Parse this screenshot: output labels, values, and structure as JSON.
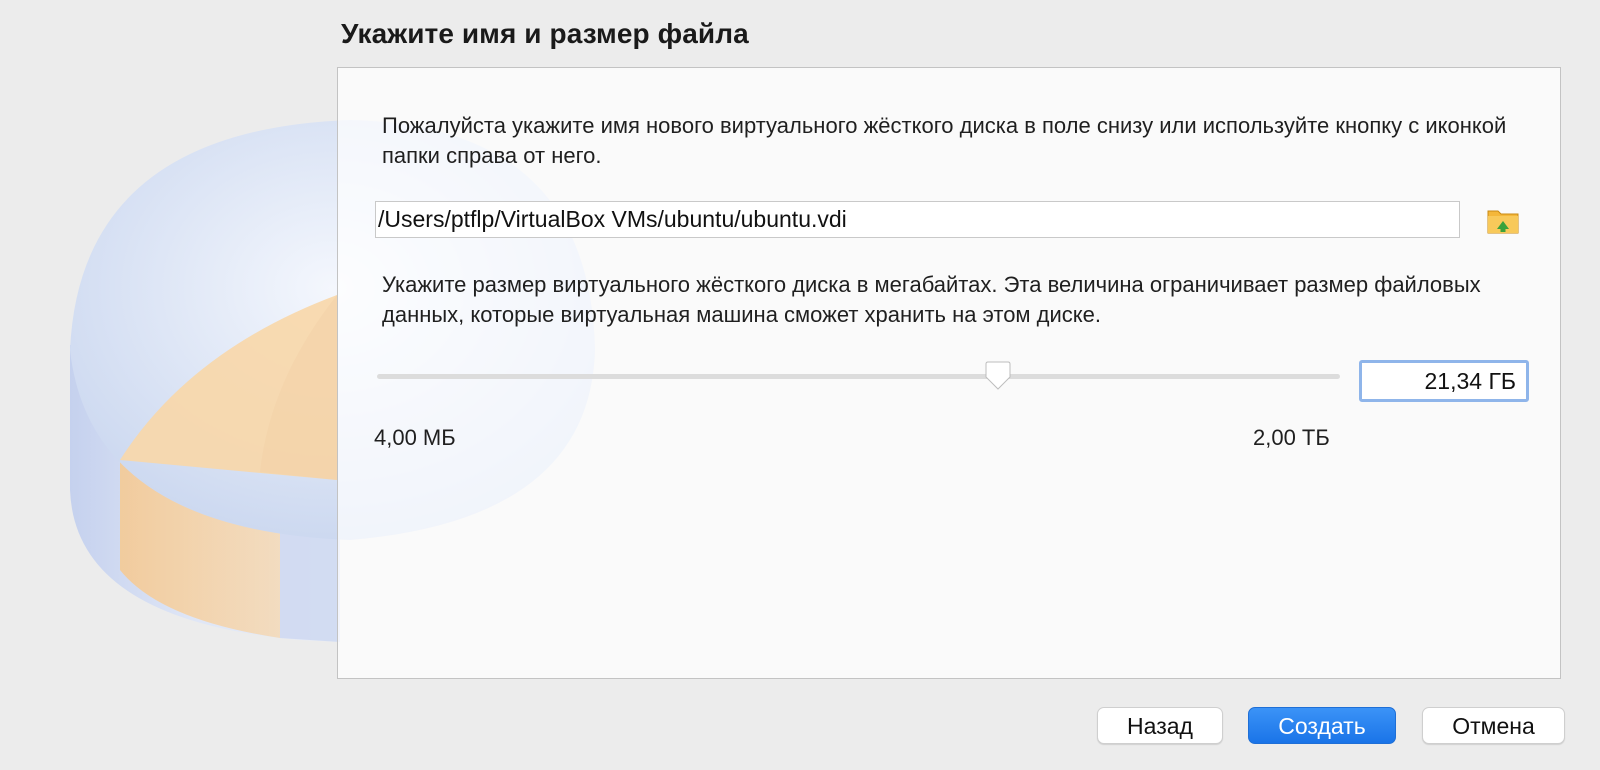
{
  "dialog": {
    "title": "Укажите имя и размер файла",
    "description_name": "Пожалуйста укажите имя нового виртуального жёсткого диска в поле снизу или используйте кнопку с иконкой папки справа от него.",
    "file_path": "/Users/ptflp/VirtualBox VMs/ubuntu/ubuntu.vdi",
    "description_size": "Укажите размер виртуального жёсткого диска в мегабайтах. Эта величина ограничивает размер файловых данных, которые виртуальная машина сможет хранить на этом диске.",
    "size_value": "21,34 ГБ",
    "size_slider_fraction": 0.645,
    "min_label": "4,00 МБ",
    "max_label": "2,00 ТБ",
    "folder_icon": "folder-browse-icon"
  },
  "buttons": {
    "back": "Назад",
    "create": "Создать",
    "cancel": "Отмена"
  },
  "colors": {
    "accent": "#1a74e8",
    "focus_ring": "#8fb5ea",
    "folder": "#f4b73a"
  }
}
